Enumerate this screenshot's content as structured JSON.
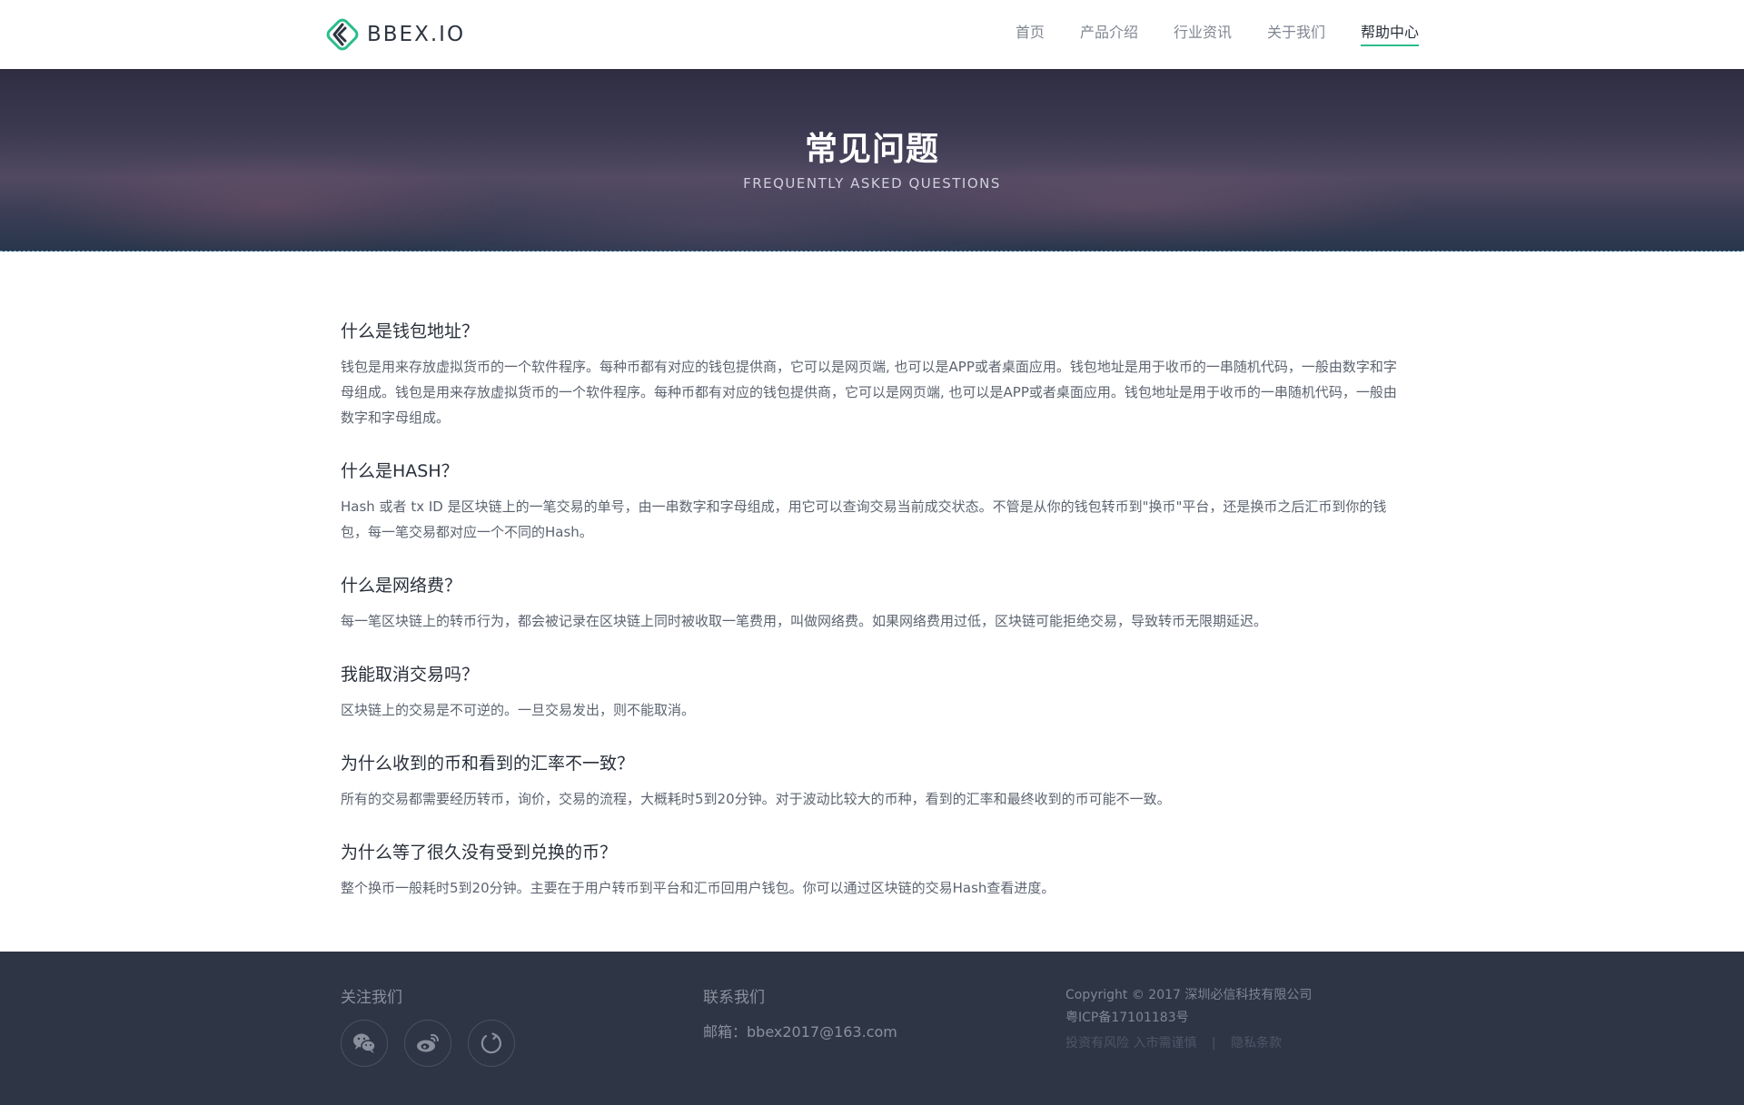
{
  "header": {
    "logo_text": "BBEX.IO",
    "nav": [
      {
        "label": "首页"
      },
      {
        "label": "产品介绍"
      },
      {
        "label": "行业资讯"
      },
      {
        "label": "关于我们"
      },
      {
        "label": "帮助中心",
        "active": true
      }
    ]
  },
  "banner": {
    "title": "常见问题",
    "subtitle": "FREQUENTLY ASKED QUESTIONS"
  },
  "faq": [
    {
      "question": "什么是钱包地址？",
      "answer": "钱包是用来存放虚拟货币的一个软件程序。每种币都有对应的钱包提供商，它可以是网页端, 也可以是APP或者桌面应用。钱包地址是用于收币的一串随机代码，一般由数字和字母组成。钱包是用来存放虚拟货币的一个软件程序。每种币都有对应的钱包提供商，它可以是网页端, 也可以是APP或者桌面应用。钱包地址是用于收币的一串随机代码，一般由数字和字母组成。"
    },
    {
      "question": "什么是HASH？",
      "answer": "Hash 或者 tx ID 是区块链上的一笔交易的单号，由一串数字和字母组成，用它可以查询交易当前成交状态。不管是从你的钱包转币到\"换币\"平台，还是换币之后汇币到你的钱包，每一笔交易都对应一个不同的Hash。"
    },
    {
      "question": "什么是网络费？",
      "answer": "每一笔区块链上的转币行为，都会被记录在区块链上同时被收取一笔费用，叫做网络费。如果网络费用过低，区块链可能拒绝交易，导致转币无限期延迟。"
    },
    {
      "question": "我能取消交易吗？",
      "answer": "区块链上的交易是不可逆的。一旦交易发出，则不能取消。"
    },
    {
      "question": "为什么收到的币和看到的汇率不一致？",
      "answer": "所有的交易都需要经历转币，询价，交易的流程，大概耗时5到20分钟。对于波动比较大的币种，看到的汇率和最终收到的币可能不一致。"
    },
    {
      "question": "为什么等了很久没有受到兑换的币？",
      "answer": "整个换币一般耗时5到20分钟。主要在于用户转币到平台和汇币回用户钱包。你可以通过区块链的交易Hash查看进度。"
    }
  ],
  "footer": {
    "follow_title": "关注我们",
    "social_icons": [
      "wechat-icon",
      "weibo-icon",
      "refresh-icon"
    ],
    "contact_title": "联系我们",
    "email": "邮箱：bbex2017@163.com",
    "copyright": "Copyright © 2017 深圳必信科技有限公司",
    "icp": "粤ICP备17101183号",
    "risk_link": "投资有风险 入市需谨慎",
    "separator": "|",
    "privacy_link": "隐私条款"
  },
  "colors": {
    "accent": "#2bbd8a",
    "footer_bg": "#2e3545"
  }
}
